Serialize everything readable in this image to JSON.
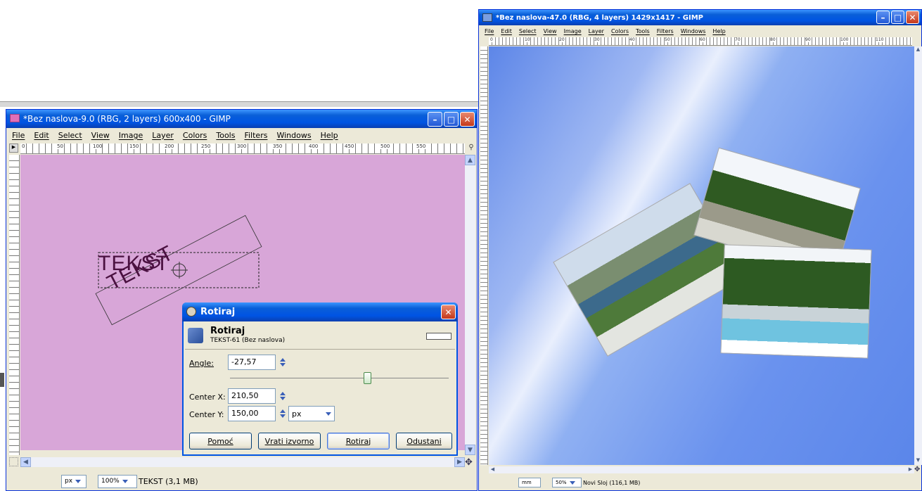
{
  "left_window": {
    "title": "*Bez naslova-9.0 (RBG, 2 layers) 600x400 - GIMP",
    "menu": [
      "File",
      "Edit",
      "Select",
      "View",
      "Image",
      "Layer",
      "Colors",
      "Tools",
      "Filters",
      "Windows",
      "Help"
    ],
    "ruler_h_ticks": [
      "0",
      "50",
      "100",
      "150",
      "200",
      "250",
      "300",
      "350",
      "400",
      "450",
      "500",
      "550"
    ],
    "ruler_v_ticks": [
      "0",
      "5",
      "1",
      "1",
      "2",
      "2",
      "3",
      "3"
    ],
    "canvas_color": "#d8a6d8",
    "text_layer": "TEKST",
    "status": {
      "unit": "px",
      "zoom": "100%",
      "info": "TEKST (3,1 MB)"
    }
  },
  "dialog": {
    "title": "Rotiraj",
    "heading": "Rotiraj",
    "subheading": "TEKST-61 (Bez naslova)",
    "angle_label": "Angle:",
    "angle_value": "-27,57",
    "angle_slider_fraction": 0.63,
    "center_x_label": "Center X:",
    "center_x_value": "210,50",
    "center_y_label": "Center Y:",
    "center_y_value": "150,00",
    "unit_value": "px",
    "buttons": {
      "help": "Pomoć",
      "reset": "Vrati izvorno",
      "rotate": "Rotiraj",
      "cancel": "Odustani"
    }
  },
  "right_window": {
    "title": "*Bez naslova-47.0 (RBG, 4 layers) 1429x1417 - GIMP",
    "menu": [
      "File",
      "Edit",
      "Select",
      "View",
      "Image",
      "Layer",
      "Colors",
      "Tools",
      "Filters",
      "Windows",
      "Help"
    ],
    "ruler_h_ticks": [
      "0",
      "10",
      "20",
      "30",
      "40",
      "50",
      "60",
      "70",
      "80",
      "90",
      "100",
      "110"
    ],
    "status": {
      "unit": "mm",
      "zoom": "50%",
      "info": "Novi Sloj (116,1 MB)"
    }
  },
  "colors": {
    "xp_blue": "#0054e3",
    "canvas_blue": "#7aa0f0",
    "close_red": "#d9512f"
  }
}
